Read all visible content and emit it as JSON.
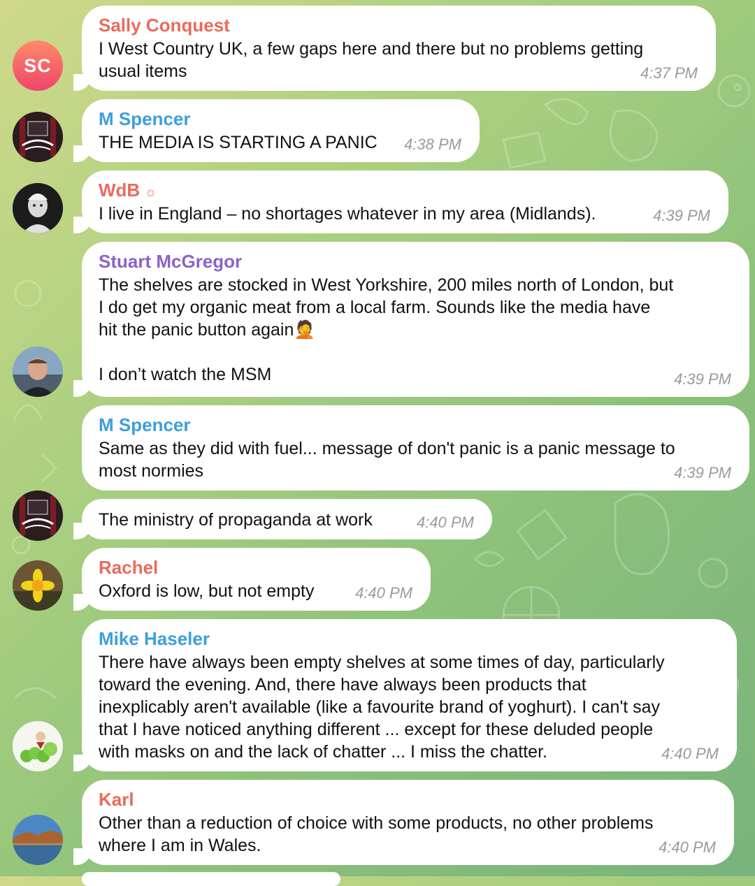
{
  "colors": {
    "red_name": "#ea6b5b",
    "blue_name": "#3c9fdc",
    "purple_name": "#8a63cb",
    "timestamp": "#9a9a9a"
  },
  "messages": [
    {
      "sender": "Sally Conquest",
      "lines": [
        "I West Country UK, a few gaps here and there but no problems getting",
        "usual items"
      ],
      "time": "4:37 PM",
      "avatar_initials": "SC"
    },
    {
      "sender": "M Spencer",
      "lines": [
        "THE MEDIA IS STARTING A PANIC"
      ],
      "time": "4:38 PM"
    },
    {
      "sender": "WdB",
      "badge_icon": "sun-star-icon",
      "lines": [
        "I live in England – no shortages whatever in my area (Midlands)."
      ],
      "time": "4:39 PM"
    },
    {
      "sender": "Stuart McGregor",
      "lines": [
        "The shelves are stocked in West Yorkshire, 200 miles north of London, but",
        "I do get my organic meat from a local farm.  Sounds like the media have",
        "hit the panic button again",
        "",
        "I don’t watch the MSM"
      ],
      "emoji": "🤦",
      "time": "4:39 PM"
    },
    {
      "sender": "M Spencer",
      "lines": [
        "Same as they did with fuel... message of don't panic is a panic message to",
        "most normies"
      ],
      "time": "4:39 PM"
    },
    {
      "sender": "",
      "lines": [
        "The ministry of propaganda at work"
      ],
      "time": "4:40 PM"
    },
    {
      "sender": "Rachel",
      "lines": [
        "Oxford is low, but not empty"
      ],
      "time": "4:40 PM"
    },
    {
      "sender": "Mike Haseler",
      "lines": [
        "There have always been empty shelves at some times of day, particularly",
        "toward the evening.  And, there have always been products that",
        "inexplicably aren't available (like a favourite brand of yoghurt). I can't say",
        "that I have noticed anything different ... except for these deluded people",
        "with masks on and the lack of chatter ... I miss the chatter."
      ],
      "time": "4:40 PM"
    },
    {
      "sender": "Karl",
      "lines": [
        "Other than a reduction of choice with some products, no other problems",
        "where I am in Wales."
      ],
      "time": "4:40 PM"
    }
  ]
}
